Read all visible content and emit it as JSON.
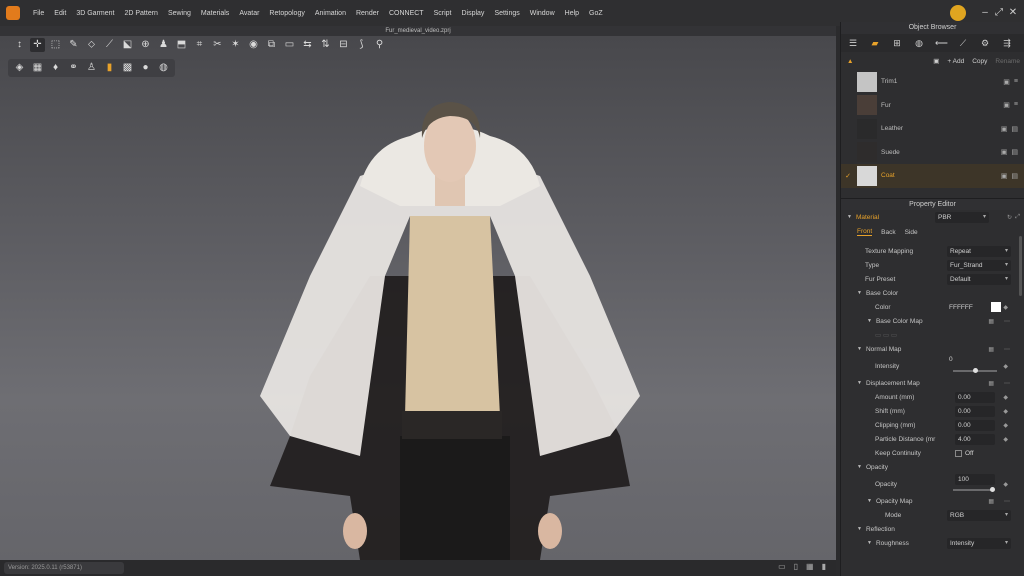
{
  "menu": [
    "File",
    "Edit",
    "3D Garment",
    "2D Pattern",
    "Sewing",
    "Materials",
    "Avatar",
    "Retopology",
    "Animation",
    "Render",
    "CONNECT",
    "Script",
    "Display",
    "Settings",
    "Window",
    "Help",
    "GoZ"
  ],
  "viewport": {
    "title": "Fur_medieval_video.zprj"
  },
  "status": {
    "version": "Version: 2025.0.11 (r53871)"
  },
  "object_browser": {
    "title": "Object Browser",
    "add_label": "+ Add",
    "copy_label": "Copy",
    "rename_label": "Rename",
    "materials": [
      {
        "name": "Trim1",
        "color": "#c4c4c4",
        "selected": false
      },
      {
        "name": "Fur",
        "color": "#4a3e38",
        "selected": false
      },
      {
        "name": "Leather",
        "color": "#2a2a2b",
        "selected": false
      },
      {
        "name": "Suede",
        "color": "#2e2c2c",
        "selected": false
      },
      {
        "name": "Coat",
        "color": "#d8d8d8",
        "selected": true
      }
    ]
  },
  "property_editor": {
    "title": "Property Editor",
    "material_label": "Material",
    "material_type": "PBR",
    "tabs": [
      "Front",
      "Back",
      "Side"
    ],
    "texture_mapping": {
      "label": "Texture Mapping",
      "value": "Repeat"
    },
    "type": {
      "label": "Type",
      "value": "Fur_Strand"
    },
    "fur_preset": {
      "label": "Fur Preset",
      "value": "Default"
    },
    "base_color": {
      "label": "Base Color",
      "color_label": "Color",
      "color_value": "FFFFFF",
      "map_label": "Base Color Map"
    },
    "normal_map": {
      "label": "Normal Map",
      "intensity_label": "Intensity",
      "intensity_value": "0"
    },
    "displacement": {
      "label": "Displacement Map",
      "rows": [
        {
          "label": "Amount (mm)",
          "value": "0.00"
        },
        {
          "label": "Shift (mm)",
          "value": "0.00"
        },
        {
          "label": "Clipping (mm)",
          "value": "0.00"
        },
        {
          "label": "Particle Distance (mr",
          "value": "4.00"
        }
      ],
      "keep_continuity_label": "Keep Continuity",
      "keep_continuity_value": "Off"
    },
    "opacity": {
      "label": "Opacity",
      "opacity_label": "Opacity",
      "opacity_value": "100",
      "map_label": "Opacity Map",
      "mode_label": "Mode",
      "mode_value": "RGB"
    },
    "reflection": {
      "label": "Reflection",
      "roughness_label": "Roughness",
      "roughness_value": "Intensity"
    }
  },
  "colors": {
    "accent": "#e8a22a",
    "panel": "#2e2e30"
  }
}
